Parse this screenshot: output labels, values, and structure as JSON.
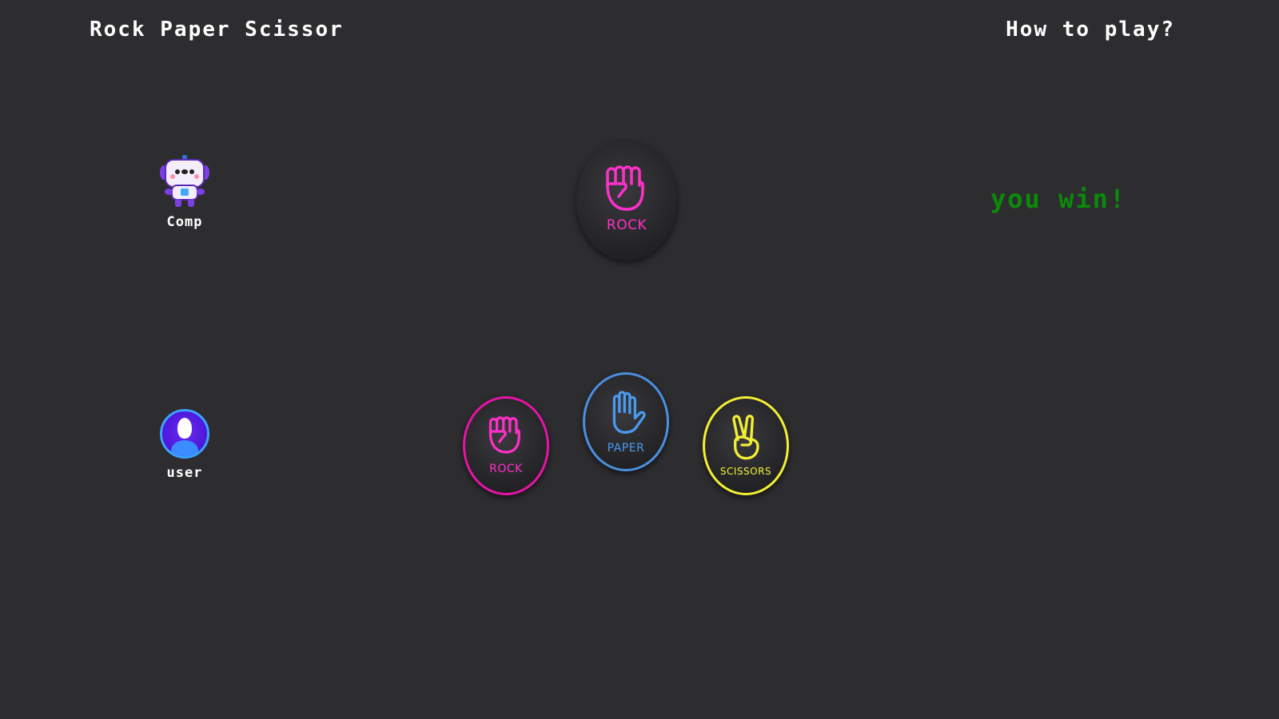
{
  "header": {
    "title": "Rock Paper Scissor",
    "how_to_play": "How to play?"
  },
  "players": {
    "computer": {
      "label": "Comp",
      "icon": "robot-icon"
    },
    "user": {
      "label": "user",
      "icon": "user-avatar-icon"
    }
  },
  "computer_choice": {
    "label": "ROCK",
    "icon": "fist-icon",
    "color": "#ff2fc9"
  },
  "result": {
    "text": "you win!",
    "color": "#0b8a0b"
  },
  "options": [
    {
      "label": "ROCK",
      "icon": "fist-icon",
      "color": "#e614a6"
    },
    {
      "label": "PAPER",
      "icon": "open-hand-icon",
      "color": "#4a8fe0"
    },
    {
      "label": "SCISSORS",
      "icon": "peace-hand-icon",
      "color": "#f3ef34"
    }
  ],
  "colors": {
    "background": "#2d2d30",
    "text": "#ffffff"
  }
}
